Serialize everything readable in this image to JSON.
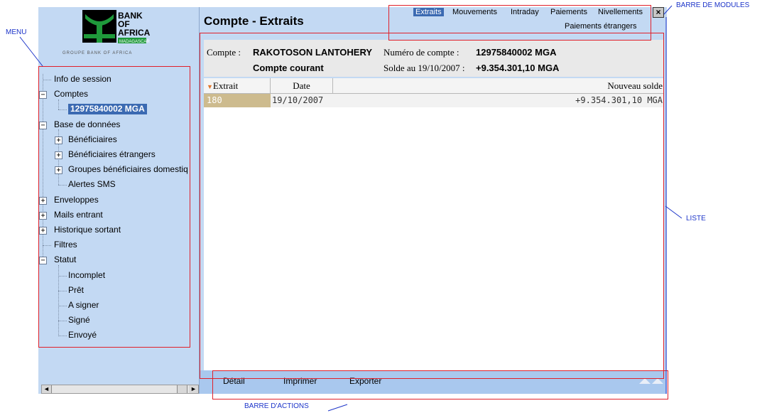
{
  "logo": {
    "line1": "BANK",
    "line2": "OF",
    "line3": "AFRICA",
    "country": "MADAGASCAR",
    "group": "GROUPE BANK OF AFRICA"
  },
  "menu": {
    "items": [
      {
        "label": "Info de session",
        "level": 0,
        "toggle": ""
      },
      {
        "label": "Comptes",
        "level": 0,
        "toggle": "−"
      },
      {
        "label": "12975840002 MGA",
        "level": 1,
        "toggle": "",
        "selected": true
      },
      {
        "label": "Base de données",
        "level": 0,
        "toggle": "−"
      },
      {
        "label": "Bénéficiaires",
        "level": 1,
        "toggle": "+"
      },
      {
        "label": "Bénéficiaires étrangers",
        "level": 1,
        "toggle": "+"
      },
      {
        "label": "Groupes bénéficiaires domestiq",
        "level": 1,
        "toggle": "+"
      },
      {
        "label": "Alertes SMS",
        "level": 1,
        "toggle": ""
      },
      {
        "label": "Enveloppes",
        "level": 0,
        "toggle": "+"
      },
      {
        "label": "Mails entrant",
        "level": 0,
        "toggle": "+"
      },
      {
        "label": "Historique sortant",
        "level": 0,
        "toggle": "+"
      },
      {
        "label": "Filtres",
        "level": 0,
        "toggle": ""
      },
      {
        "label": "Statut",
        "level": 0,
        "toggle": "−"
      },
      {
        "label": "Incomplet",
        "level": 1,
        "toggle": ""
      },
      {
        "label": "Prêt",
        "level": 1,
        "toggle": ""
      },
      {
        "label": "A signer",
        "level": 1,
        "toggle": ""
      },
      {
        "label": "Signé",
        "level": 1,
        "toggle": ""
      },
      {
        "label": "Envoyé",
        "level": 1,
        "toggle": ""
      }
    ]
  },
  "header": {
    "title": "Compte - Extraits"
  },
  "modules": {
    "row1": [
      "Extraits",
      "Mouvements",
      "Intraday",
      "Paiements",
      "Nivellements"
    ],
    "row2": [
      "Paiements étrangers"
    ],
    "active": "Extraits",
    "close": "×"
  },
  "account": {
    "compte_label": "Compte :",
    "holder": "RAKOTOSON LANTOHERY",
    "type": "Compte courant",
    "number_label": "Numéro de compte :",
    "number": "12975840002 MGA",
    "balance_label": "Solde au 19/10/2007 :",
    "balance": "+9.354.301,10 MGA"
  },
  "table": {
    "columns": [
      "Extrait",
      "Date",
      "Nouveau solde"
    ],
    "sort_indicator": "▼",
    "rows": [
      [
        "180",
        "19/10/2007",
        "+9.354.301,10 MGA"
      ]
    ]
  },
  "actions": {
    "detail": "Détail",
    "print": "Imprimer",
    "export": "Exporter"
  },
  "annotations": {
    "menu": "MENU",
    "modules": "BARRE DE MODULES",
    "list": "LISTE",
    "actions": "BARRE D'ACTIONS"
  },
  "colors": {
    "pane": "#c3d9f3",
    "selected": "#3b6ab2",
    "annotation_box": "#e0202a",
    "annotation_text": "#1d35c9",
    "extract_cell": "#cdbb8e"
  }
}
